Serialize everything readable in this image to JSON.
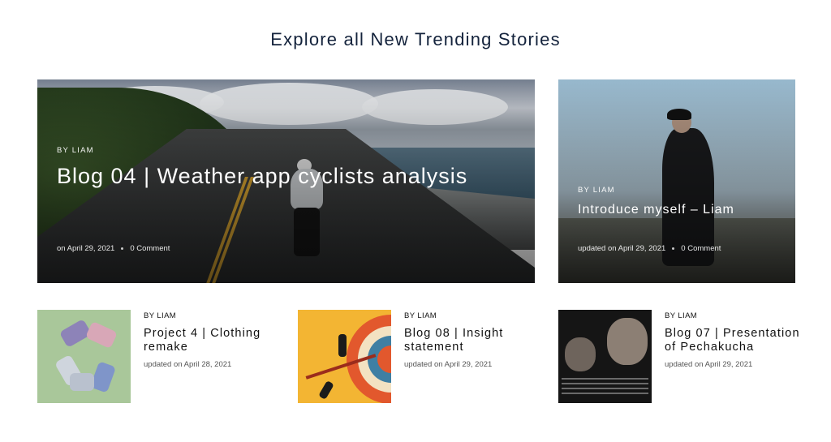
{
  "section": {
    "title": "Explore all New Trending Stories"
  },
  "featured": [
    {
      "author": "BY LIAM",
      "title": "Blog 04 | Weather app cyclists analysis",
      "date": "on April 29, 2021",
      "comments": "0 Comment",
      "image": "cyclist-coastal-road-photo"
    },
    {
      "author": "BY LIAM",
      "title": "Introduce myself – Liam",
      "date": "updated on April 29, 2021",
      "comments": "0 Comment",
      "image": "man-in-black-coat-photo"
    }
  ],
  "stories": [
    {
      "author": "BY LIAM",
      "title": "Project 4 | Clothing remake",
      "date_label": "updated on",
      "date": "April 28, 2021",
      "image": "fabric-recycle-symbol-thumbnail"
    },
    {
      "author": "BY LIAM",
      "title": "Blog 08 | Insight statement",
      "date_label": "updated on",
      "date": "April 29, 2021",
      "image": "target-dart-illustration-thumbnail"
    },
    {
      "author": "BY LIAM",
      "title": "Blog 07 | Presentation of Pechakucha",
      "date_label": "updated on",
      "date": "April 29, 2021",
      "image": "elderly-women-photo-thumbnail"
    }
  ]
}
